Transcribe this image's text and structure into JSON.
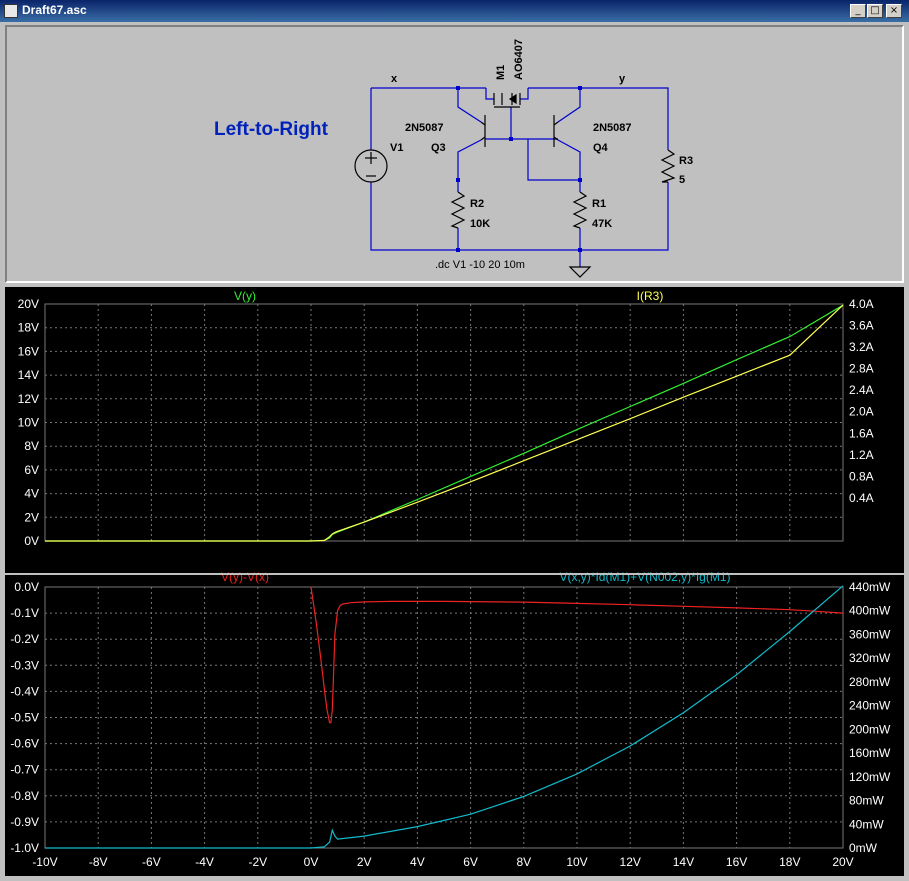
{
  "window": {
    "title": "Draft67.asc",
    "buttons": {
      "minimize": "_",
      "maximize": "□",
      "close": "×"
    }
  },
  "schematic": {
    "heading": "Left-to-Right",
    "nets": {
      "x": "x",
      "y": "y"
    },
    "components": {
      "M1": {
        "ref": "M1",
        "value": "AO6407"
      },
      "Q3": {
        "ref": "Q3",
        "value": "2N5087"
      },
      "Q4": {
        "ref": "Q4",
        "value": "2N5087"
      },
      "V1": {
        "ref": "V1"
      },
      "R1": {
        "ref": "R1",
        "value": "47K"
      },
      "R2": {
        "ref": "R2",
        "value": "10K"
      },
      "R3": {
        "ref": "R3",
        "value": "5"
      }
    },
    "directive": ".dc V1 -10 20 10m"
  },
  "colors": {
    "v_y": "#33ee33",
    "i_r3": "#ffff55",
    "v_diff": "#ee2222",
    "power": "#11bbcc",
    "grid": "#777777",
    "axis_text": "#ffffff"
  },
  "chart_data": [
    {
      "type": "line",
      "pane": "top",
      "x_ticks": [
        "-10V",
        "-8V",
        "-6V",
        "-4V",
        "-2V",
        "0V",
        "2V",
        "4V",
        "6V",
        "8V",
        "10V",
        "12V",
        "14V",
        "16V",
        "18V",
        "20V"
      ],
      "xlim": [
        -10,
        20
      ],
      "y_left_ticks": [
        "0V",
        "2V",
        "4V",
        "6V",
        "8V",
        "10V",
        "12V",
        "14V",
        "16V",
        "18V",
        "20V"
      ],
      "y_left_lim": [
        0,
        20
      ],
      "y_right_ticks": [
        "0.4A",
        "0.8A",
        "1.2A",
        "1.6A",
        "2.0A",
        "2.4A",
        "2.8A",
        "3.2A",
        "3.6A",
        "4.0A"
      ],
      "y_right_lim": [
        -0.4,
        4.0
      ],
      "series": [
        {
          "name": "V(y)",
          "axis": "left",
          "x": [
            -10,
            -4,
            0,
            0.5,
            0.7,
            0.8,
            1,
            2,
            4,
            6,
            8,
            10,
            12,
            14,
            16,
            18,
            20
          ],
          "y": [
            0,
            0,
            0,
            0.05,
            0.25,
            0.55,
            0.75,
            1.6,
            3.5,
            5.45,
            7.4,
            9.4,
            11.35,
            13.3,
            15.3,
            17.25,
            19.9
          ]
        },
        {
          "name": "I(R3)",
          "axis": "right",
          "x": [
            -10,
            0,
            0.5,
            0.7,
            0.8,
            0.9,
            1,
            2,
            4,
            6,
            8,
            10,
            12,
            14,
            16,
            18,
            20
          ],
          "y": [
            -0.4,
            -0.4,
            -0.39,
            -0.32,
            -0.27,
            -0.24,
            -0.22,
            -0.05,
            0.32,
            0.7,
            1.09,
            1.48,
            1.87,
            2.27,
            2.66,
            3.05,
            3.98
          ]
        }
      ]
    },
    {
      "type": "line",
      "pane": "bottom",
      "x_ticks": [
        "-10V",
        "-8V",
        "-6V",
        "-4V",
        "-2V",
        "0V",
        "2V",
        "4V",
        "6V",
        "8V",
        "10V",
        "12V",
        "14V",
        "16V",
        "18V",
        "20V"
      ],
      "xlim": [
        -10,
        20
      ],
      "y_left_ticks": [
        "-1.0V",
        "-0.9V",
        "-0.8V",
        "-0.7V",
        "-0.6V",
        "-0.5V",
        "-0.4V",
        "-0.3V",
        "-0.2V",
        "-0.1V",
        "0.0V"
      ],
      "y_left_lim": [
        -1.0,
        0.0
      ],
      "y_right_ticks": [
        "0mW",
        "40mW",
        "80mW",
        "120mW",
        "160mW",
        "200mW",
        "240mW",
        "280mW",
        "320mW",
        "360mW",
        "400mW",
        "440mW"
      ],
      "y_right_lim": [
        0,
        440
      ],
      "series": [
        {
          "name": "V(y)-V(x)",
          "axis": "left",
          "x": [
            0,
            0.1,
            0.2,
            0.3,
            0.4,
            0.5,
            0.6,
            0.7,
            0.75,
            0.8,
            0.85,
            0.9,
            1.0,
            1.1,
            1.2,
            1.5,
            2,
            3,
            4,
            5,
            6,
            7,
            8,
            10,
            12,
            14,
            16,
            18,
            19,
            20
          ],
          "y": [
            0.0,
            -0.07,
            -0.14,
            -0.22,
            -0.3,
            -0.39,
            -0.47,
            -0.52,
            -0.52,
            -0.47,
            -0.33,
            -0.18,
            -0.09,
            -0.07,
            -0.065,
            -0.06,
            -0.057,
            -0.055,
            -0.055,
            -0.055,
            -0.056,
            -0.057,
            -0.058,
            -0.063,
            -0.068,
            -0.074,
            -0.08,
            -0.087,
            -0.093,
            -0.1
          ]
        },
        {
          "name": "V(x,y)*Id(M1)+V(N002,y)*Ig(M1)",
          "axis": "right",
          "x": [
            -10,
            0,
            0.5,
            0.7,
            0.8,
            0.9,
            1,
            2,
            4,
            6,
            8,
            10,
            12,
            14,
            16,
            18,
            20
          ],
          "y": [
            0,
            0,
            2,
            10,
            30,
            20,
            15,
            20,
            36,
            57,
            87,
            125,
            172,
            228,
            292,
            365,
            442
          ]
        }
      ]
    }
  ]
}
